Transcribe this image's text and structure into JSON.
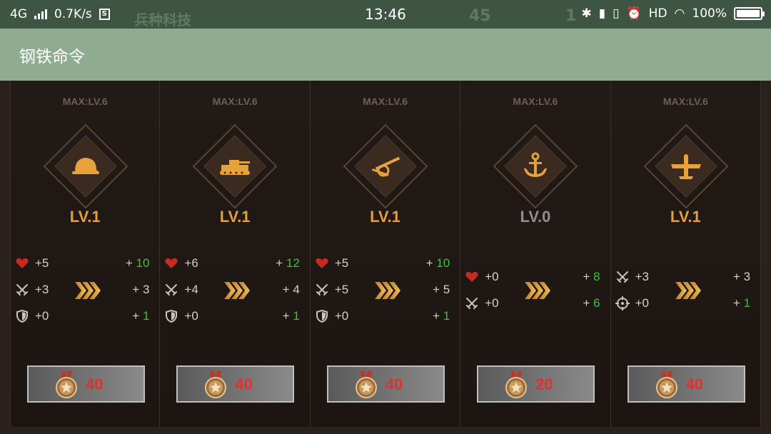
{
  "status_bar": {
    "network": "4G",
    "speed": "0.7K/s",
    "time": "13:46",
    "battery": "100%",
    "hd": "HD"
  },
  "background_header": {
    "title": "兵种科技",
    "count_1": "45",
    "count_2": "1"
  },
  "app_bar": {
    "title": "钢铁命令"
  },
  "colors": {
    "accent_level": "#e29f3b",
    "level_disabled": "#8f8f8f",
    "gain_green": "#3ec33a",
    "cost_red": "#e3302d",
    "app_bar": "#8fac91"
  },
  "cards": [
    {
      "unit_icon": "helmet-icon",
      "max_label": "MAX:LV.6",
      "level": "LV.1",
      "stats": [
        {
          "icon": "heart-icon",
          "current": "+5",
          "plus": "+",
          "next": "10",
          "green": true
        },
        {
          "icon": "crossed-swords-icon",
          "current": "+3",
          "plus": "+",
          "next": "3",
          "green": false
        },
        {
          "icon": "shield-icon",
          "current": "+0",
          "plus": "+",
          "next": "1",
          "green": true
        }
      ],
      "cost": "40"
    },
    {
      "unit_icon": "tank-icon",
      "max_label": "MAX:LV.6",
      "level": "LV.1",
      "stats": [
        {
          "icon": "heart-icon",
          "current": "+6",
          "plus": "+",
          "next": "12",
          "green": true
        },
        {
          "icon": "crossed-swords-icon",
          "current": "+4",
          "plus": "+",
          "next": "4",
          "green": false
        },
        {
          "icon": "shield-icon",
          "current": "+0",
          "plus": "+",
          "next": "1",
          "green": true
        }
      ],
      "cost": "40"
    },
    {
      "unit_icon": "artillery-icon",
      "max_label": "MAX:LV.6",
      "level": "LV.1",
      "stats": [
        {
          "icon": "heart-icon",
          "current": "+5",
          "plus": "+",
          "next": "10",
          "green": true
        },
        {
          "icon": "crossed-swords-icon",
          "current": "+5",
          "plus": "+",
          "next": "5",
          "green": false
        },
        {
          "icon": "shield-icon",
          "current": "+0",
          "plus": "+",
          "next": "1",
          "green": true
        }
      ],
      "cost": "40"
    },
    {
      "unit_icon": "anchor-icon",
      "max_label": "MAX:LV.6",
      "level": "LV.0",
      "stats": [
        {
          "icon": "heart-icon",
          "current": "+0",
          "plus": "+",
          "next": "8",
          "green": true
        },
        {
          "icon": "crossed-swords-icon",
          "current": "+0",
          "plus": "+",
          "next": "6",
          "green": true
        }
      ],
      "cost": "20"
    },
    {
      "unit_icon": "airplane-icon",
      "max_label": "MAX:LV.6",
      "level": "LV.1",
      "stats": [
        {
          "icon": "crossed-swords-icon",
          "current": "+3",
          "plus": "+",
          "next": "3",
          "green": false
        },
        {
          "icon": "crosshair-icon",
          "current": "+0",
          "plus": "+",
          "next": "1",
          "green": true
        }
      ],
      "cost": "40"
    }
  ]
}
